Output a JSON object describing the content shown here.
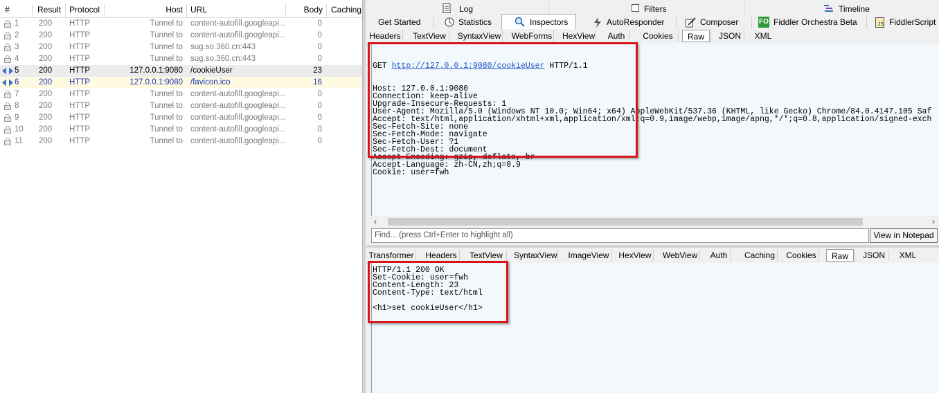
{
  "sessions": {
    "columns": [
      "#",
      "Result",
      "Protocol",
      "Host",
      "URL",
      "Body",
      "Caching"
    ],
    "rows": [
      {
        "num": "1",
        "result": "200",
        "protocol": "HTTP",
        "host": "Tunnel to",
        "url": "content-autofill.googleapi...",
        "body": "0",
        "icon": "lock-icon",
        "style": "gray"
      },
      {
        "num": "2",
        "result": "200",
        "protocol": "HTTP",
        "host": "Tunnel to",
        "url": "content-autofill.googleapi...",
        "body": "0",
        "icon": "lock-icon",
        "style": "gray"
      },
      {
        "num": "3",
        "result": "200",
        "protocol": "HTTP",
        "host": "Tunnel to",
        "url": "sug.so.360.cn:443",
        "body": "0",
        "icon": "lock-icon",
        "style": "gray"
      },
      {
        "num": "4",
        "result": "200",
        "protocol": "HTTP",
        "host": "Tunnel to",
        "url": "sug.so.360.cn:443",
        "body": "0",
        "icon": "lock-icon",
        "style": "gray"
      },
      {
        "num": "5",
        "result": "200",
        "protocol": "HTTP",
        "host": "127.0.0.1:9080",
        "url": "/cookieUser",
        "body": "23",
        "icon": "request-arrows-icon",
        "style": "sel"
      },
      {
        "num": "6",
        "result": "200",
        "protocol": "HTTP",
        "host": "127.0.0.1:9080",
        "url": "/favicon.ico",
        "body": "16",
        "icon": "request-arrows-icon",
        "style": "alt"
      },
      {
        "num": "7",
        "result": "200",
        "protocol": "HTTP",
        "host": "Tunnel to",
        "url": "content-autofill.googleapi...",
        "body": "0",
        "icon": "lock-icon",
        "style": "gray"
      },
      {
        "num": "8",
        "result": "200",
        "protocol": "HTTP",
        "host": "Tunnel to",
        "url": "content-autofill.googleapi...",
        "body": "0",
        "icon": "lock-icon",
        "style": "gray"
      },
      {
        "num": "9",
        "result": "200",
        "protocol": "HTTP",
        "host": "Tunnel to",
        "url": "content-autofill.googleapi...",
        "body": "0",
        "icon": "lock-icon",
        "style": "gray"
      },
      {
        "num": "10",
        "result": "200",
        "protocol": "HTTP",
        "host": "Tunnel to",
        "url": "content-autofill.googleapi...",
        "body": "0",
        "icon": "lock-icon",
        "style": "gray"
      },
      {
        "num": "11",
        "result": "200",
        "protocol": "HTTP",
        "host": "Tunnel to",
        "url": "content-autofill.googleapi...",
        "body": "0",
        "icon": "lock-icon",
        "style": "gray"
      }
    ]
  },
  "top_tabs_row1": [
    "Log",
    "Filters",
    "Timeline"
  ],
  "top_tabs_row2": [
    "Get Started",
    "Statistics",
    "Inspectors",
    "AutoResponder",
    "Composer",
    "Fiddler Orchestra Beta",
    "FiddlerScript"
  ],
  "orchestra_badge": "FO",
  "request_tabs": [
    "Headers",
    "TextView",
    "SyntaxView",
    "WebForms",
    "HexView",
    "Auth",
    "Cookies",
    "Raw",
    "JSON",
    "XML"
  ],
  "request": {
    "method": "GET",
    "url": "http://127.0.0.1:9080/cookieUser",
    "version": "HTTP/1.1",
    "lines": [
      "Host: 127.0.0.1:9080",
      "Connection: keep-alive",
      "Upgrade-Insecure-Requests: 1",
      "User-Agent: Mozilla/5.0 (Windows NT 10.0; Win64; x64) AppleWebKit/537.36 (KHTML, like Gecko) Chrome/84.0.4147.105 Saf",
      "Accept: text/html,application/xhtml+xml,application/xml;q=0.9,image/webp,image/apng,*/*;q=0.8,application/signed-exch",
      "Sec-Fetch-Site: none",
      "Sec-Fetch-Mode: navigate",
      "Sec-Fetch-User: ?1",
      "Sec-Fetch-Dest: document",
      "Accept-Encoding: gzip, deflate, br",
      "Accept-Language: zh-CN,zh;q=0.9",
      "Cookie: user=fwh"
    ]
  },
  "find": {
    "placeholder": "Find... (press Ctrl+Enter to highlight all)",
    "notepad_button": "View in Notepad"
  },
  "response_tabs": [
    "Transformer",
    "Headers",
    "TextView",
    "SyntaxView",
    "ImageView",
    "HexView",
    "WebView",
    "Auth",
    "Caching",
    "Cookies",
    "Raw",
    "JSON",
    "XML"
  ],
  "response": {
    "lines": [
      "HTTP/1.1 200 OK",
      "Set-Cookie: user=fwh",
      "Content-Length: 23",
      "Content-Type: text/html",
      "",
      "<h1>set cookieUser</h1>"
    ]
  },
  "colors": {
    "highlight_box": "#d8141b",
    "link": "#1f56c4",
    "pane_bg": "#f2f8fc",
    "selected_row_text": "#1c33b8"
  }
}
